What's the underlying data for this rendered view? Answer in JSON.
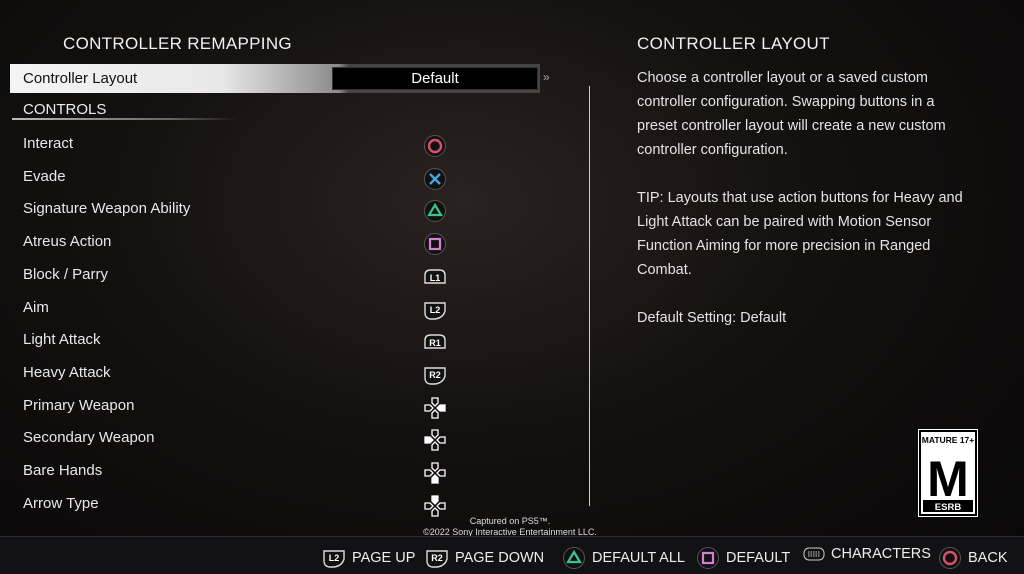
{
  "left": {
    "title": "CONTROLLER REMAPPING",
    "layout_row": {
      "label": "Controller Layout",
      "value": "Default",
      "arrows": "»"
    },
    "section": "CONTROLS",
    "controls": [
      {
        "label": "Interact",
        "button": "circle"
      },
      {
        "label": "Evade",
        "button": "cross"
      },
      {
        "label": "Signature Weapon Ability",
        "button": "triangle"
      },
      {
        "label": "Atreus Action",
        "button": "square"
      },
      {
        "label": "Block / Parry",
        "button": "L1"
      },
      {
        "label": "Aim",
        "button": "L2"
      },
      {
        "label": "Light Attack",
        "button": "R1"
      },
      {
        "label": "Heavy Attack",
        "button": "R2"
      },
      {
        "label": "Primary Weapon",
        "button": "dpad-right"
      },
      {
        "label": "Secondary Weapon",
        "button": "dpad-left"
      },
      {
        "label": "Bare Hands",
        "button": "dpad-down"
      },
      {
        "label": "Arrow Type",
        "button": "dpad-up"
      }
    ]
  },
  "right": {
    "title": "CONTROLLER LAYOUT",
    "paragraphs": [
      "Choose a controller layout or a saved custom controller configuration. Swapping buttons in a preset controller layout will create a new custom controller configuration.",
      "TIP: Layouts that use action buttons for Heavy and Light Attack can be paired with Motion Sensor Function Aiming for more precision in Ranged Combat.",
      "Default Setting: Default"
    ]
  },
  "rating": {
    "top": "MATURE 17+",
    "letter": "M",
    "bottom": "ESRB"
  },
  "capture": {
    "line1": "Captured on PS5™.",
    "line2": "©2022 Sony Interactive Entertainment LLC."
  },
  "footer": [
    {
      "button": "L2",
      "label": "PAGE UP"
    },
    {
      "button": "R2",
      "label": "PAGE DOWN"
    },
    {
      "button": "triangle",
      "label": "DEFAULT ALL"
    },
    {
      "button": "square",
      "label": "DEFAULT"
    },
    {
      "button": "touchpad",
      "label": "CHARACTERS"
    },
    {
      "button": "circle",
      "label": "BACK"
    }
  ],
  "colors": {
    "circle": "#d9506c",
    "cross": "#4aa3dc",
    "triangle": "#3fc291",
    "square": "#d47fcf"
  }
}
